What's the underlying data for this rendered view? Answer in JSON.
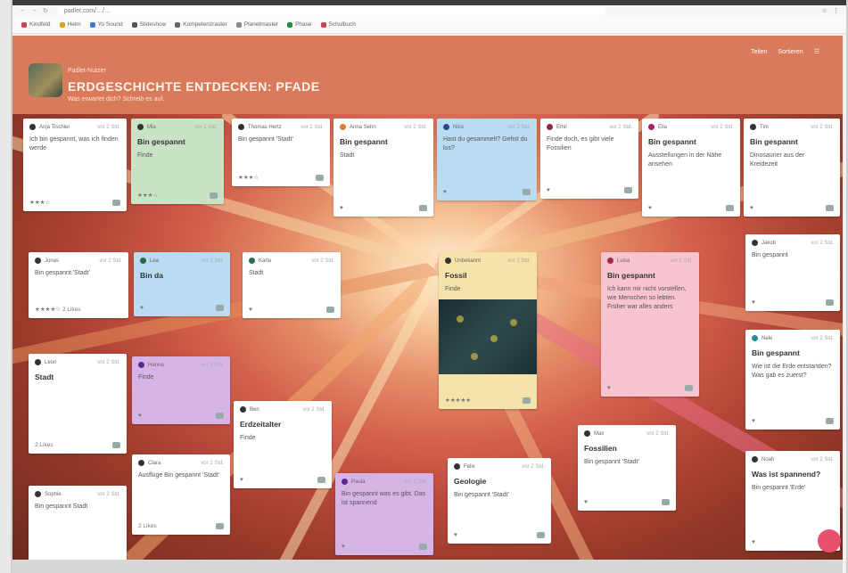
{
  "browser": {
    "url": "padlet.com/…/…",
    "bookmarks": [
      "Kindfeld",
      "Heim",
      "Yo Sound",
      "Slideshow",
      "Kompetenzraster",
      "Planetmaster",
      "Phase",
      "Schulbuch"
    ]
  },
  "board": {
    "owner": "Padlet-Nutzer",
    "title": "ERDGESCHICHTE ENTDECKEN: PFADE",
    "subtitle": "Was erwartet dich? Schreib es auf.",
    "actions": [
      "Teilen",
      "Sortieren",
      "☰"
    ]
  },
  "cards": [
    {
      "id": "c1",
      "author": "Anja Tischler",
      "time": "vor 2 Std.",
      "title": "",
      "body": "Ich bin gespannt, was ich finden werde",
      "foot": "★★★☆"
    },
    {
      "id": "c2",
      "author": "Mia",
      "time": "vor 2 Std.",
      "title": "Bin gespannt",
      "body": "Finde",
      "foot": "★★★☆"
    },
    {
      "id": "c3",
      "author": "Thomas Hertz",
      "time": "vor 2 Std.",
      "title": "",
      "body": "Bin gespannt 'Stadt'",
      "foot": "★★★☆"
    },
    {
      "id": "c4",
      "author": "Anna Sehn",
      "time": "vor 2 Std.",
      "title": "Bin gespannt",
      "body": "Stadt",
      "foot": "♥"
    },
    {
      "id": "c5",
      "author": "Nico",
      "time": "vor 2 Std.",
      "title": "",
      "body": "Hast du gesammelt? Gehst du los?",
      "foot": "♥"
    },
    {
      "id": "c6",
      "author": "Emil",
      "time": "vor 2 Std.",
      "title": "",
      "body": "Finde doch, es gibt viele Fossilien",
      "foot": "♥"
    },
    {
      "id": "c7",
      "author": "Ella",
      "time": "vor 2 Std.",
      "title": "Bin gespannt",
      "body": "Ausstellungen in der Nähe ansehen",
      "foot": "♥"
    },
    {
      "id": "c8",
      "author": "Tim",
      "time": "vor 2 Std.",
      "title": "Bin gespannt",
      "body": "Dinosaurier aus der Kreidezeit",
      "foot": "♥"
    },
    {
      "id": "c9",
      "author": "Jonas",
      "time": "vor 2 Std.",
      "title": "",
      "body": "Bin gespannt 'Stadt'",
      "foot": "★★★★☆ 2 Likes"
    },
    {
      "id": "c10",
      "author": "Lea",
      "time": "vor 2 Std.",
      "title": "Bin da",
      "body": "",
      "foot": "♥"
    },
    {
      "id": "c11",
      "author": "Karla",
      "time": "vor 2 Std.",
      "title": "",
      "body": "Stadt",
      "foot": "♥"
    },
    {
      "id": "c12",
      "author": "Unbekannt",
      "time": "vor 2 Std.",
      "title": "Fossil",
      "body": "Finde",
      "foot": "★★★★★"
    },
    {
      "id": "c13",
      "author": "Luisa",
      "time": "vor 2 Std.",
      "title": "Bin gespannt",
      "body": "Ich kann mir nicht vorstellen, wie Menschen so lebten. Früher war alles anders",
      "foot": "♥"
    },
    {
      "id": "c14",
      "author": "Jakob",
      "time": "vor 2 Std.",
      "title": "",
      "body": "Bin gespannt",
      "foot": "♥"
    },
    {
      "id": "c15",
      "author": "Nele",
      "time": "vor 2 Std.",
      "title": "Bin gespannt",
      "body": "Wie ist die Erde entstanden? Was gab es zuerst?",
      "foot": "♥"
    },
    {
      "id": "c16",
      "author": "Leon",
      "time": "vor 2 Std.",
      "title": "Stadt",
      "body": "",
      "foot": "2 Likes"
    },
    {
      "id": "c17",
      "author": "Hanna",
      "time": "vor 2 Std.",
      "title": "",
      "body": "Finde",
      "foot": "♥"
    },
    {
      "id": "c18",
      "author": "Ben",
      "time": "vor 2 Std.",
      "title": "Erdzeitalter",
      "body": "Finde",
      "foot": "♥"
    },
    {
      "id": "c19",
      "author": "Clara",
      "time": "vor 2 Std.",
      "title": "",
      "body": "Ausflüge Bin gespannt 'Stadt'",
      "foot": "2 Likes"
    },
    {
      "id": "c20",
      "author": "Paula",
      "time": "vor 2 Std.",
      "title": "",
      "body": "Bin gespannt was es gibt. Das ist spannend",
      "foot": "♥"
    },
    {
      "id": "c21",
      "author": "Felix",
      "time": "vor 2 Std.",
      "title": "Geologie",
      "body": "Bin gespannt 'Stadt'",
      "foot": "♥"
    },
    {
      "id": "c22",
      "author": "Max",
      "time": "vor 2 Std.",
      "title": "Fossilien",
      "body": "Bin gespannt 'Stadt'",
      "foot": "♥"
    },
    {
      "id": "c23",
      "author": "Sophie",
      "time": "vor 2 Std.",
      "title": "",
      "body": "Bin gespannt Stadt",
      "foot": "♥"
    },
    {
      "id": "c24",
      "author": "Noah",
      "time": "vor 2 Std.",
      "title": "Was ist spannend?",
      "body": "Bin gespannt 'Erde'",
      "foot": "♥"
    }
  ]
}
